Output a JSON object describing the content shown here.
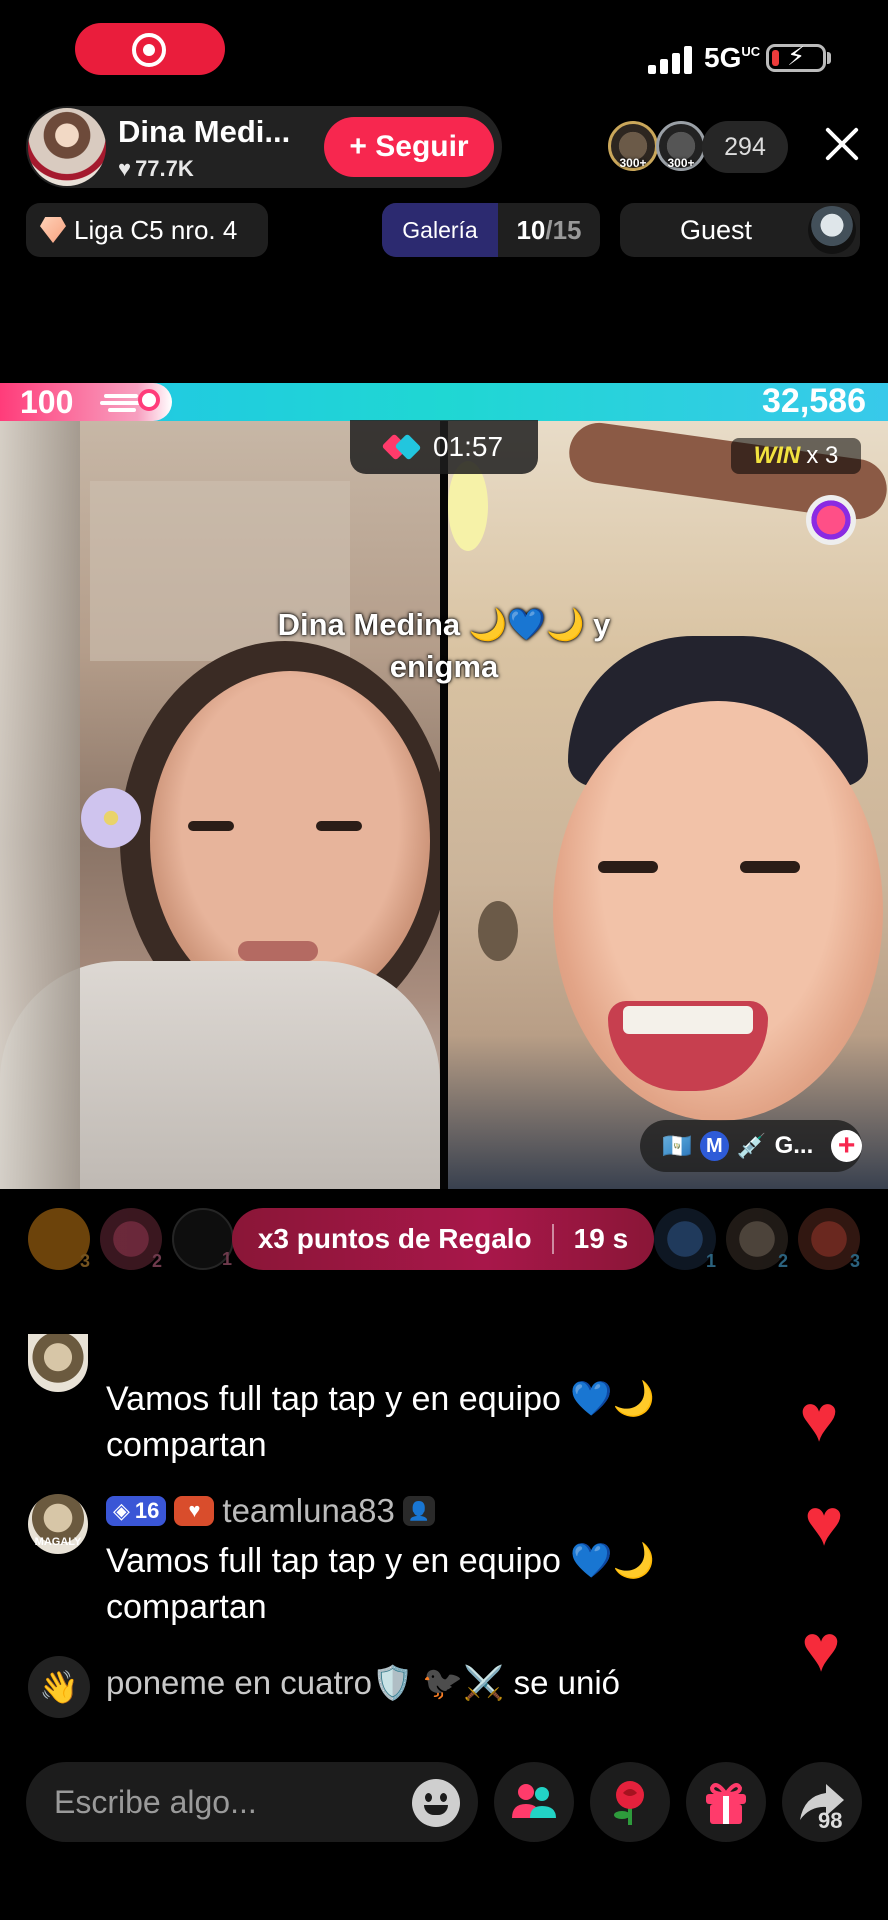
{
  "host": {
    "name": "Dina Medi...",
    "likes": "77.7K",
    "follow_label": "+ Seguir"
  },
  "viewers": {
    "top": [
      {
        "rank": "300+"
      },
      {
        "rank": "300+"
      }
    ],
    "count": "294"
  },
  "status_bar": {
    "network": "5G",
    "network_sup": "UC"
  },
  "info_row": {
    "league": "Liga C5 nro. 4",
    "gallery_label": "Galería",
    "gallery_current": "10",
    "gallery_total": "/15",
    "guest_label": "Guest"
  },
  "battle": {
    "left_score": "100",
    "right_score": "32,586",
    "timer": "01:57",
    "win_label": "WIN",
    "win_multiplier": "x 3",
    "title_line1": "Dina Medina 🌙💙🌙 y",
    "title_line2": "enigma",
    "left_share": 0.003
  },
  "guest_tag": {
    "flag": "🇬🇹",
    "badge": "M",
    "tool": "💉",
    "name": "G..."
  },
  "gift_banner": {
    "text": "x3 puntos de Regalo",
    "countdown": "19 s"
  },
  "left_ranks": [
    "3",
    "2",
    "1"
  ],
  "right_ranks": [
    "1",
    "2",
    "3"
  ],
  "chat": {
    "messages": [
      {
        "text_line1": "Vamos full tap tap y en equipo 💙🌙",
        "text_line2": "compartan"
      },
      {
        "level": "16",
        "username": "teamluna83",
        "text_line1": "Vamos full tap tap y en equipo 💙🌙",
        "text_line2": "compartan"
      }
    ],
    "join": {
      "username": "poneme en cuatro🛡️ 🐦‍⬛⚔️",
      "joined_text": "se unió"
    },
    "avatar_label": "MAGALY"
  },
  "bottom_bar": {
    "input_placeholder": "Escribe algo...",
    "share_count": "98"
  },
  "icons": {
    "rec": "record-icon",
    "heart": "heart-icon",
    "close": "close-icon",
    "gem": "gem-icon",
    "emoji": "smiley-icon",
    "multi_guest": "multi-guest-icon",
    "rose": "rose-icon",
    "gift": "gift-icon",
    "share": "share-icon",
    "wave": "wave-icon"
  },
  "colors": {
    "brand_red": "#f7274f",
    "battle_pink": "#ff3c7a",
    "battle_cyan": "#22c4e8",
    "gallery_blue": "#2c2a70",
    "banner_red": "#a8174a"
  }
}
